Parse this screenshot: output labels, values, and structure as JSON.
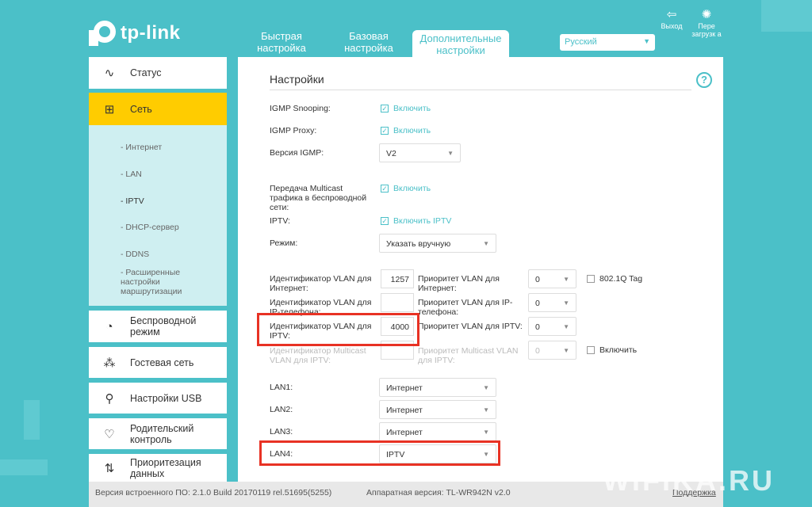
{
  "brand": "tp-link",
  "tabs": [
    {
      "line1": "Быстрая",
      "line2": "настройка"
    },
    {
      "line1": "Базовая",
      "line2": "настройка"
    },
    {
      "line1": "Дополнительные",
      "line2": "настройки"
    }
  ],
  "language": "Русский",
  "top_actions": {
    "logout": "Выход",
    "reboot": "Пере загрузк а"
  },
  "sidebar": {
    "items": [
      {
        "label": "Статус",
        "icon": "pulse-icon"
      },
      {
        "label": "Сеть",
        "icon": "network-icon"
      },
      {
        "label": "Беспроводной режим",
        "icon": "wifi-icon"
      },
      {
        "label": "Гостевая сеть",
        "icon": "guests-icon"
      },
      {
        "label": "Настройки USB",
        "icon": "usb-icon"
      },
      {
        "label": "Родительский контроль",
        "icon": "heart-icon"
      },
      {
        "label": "Приоритезация данных",
        "icon": "arrows-icon"
      }
    ],
    "submenu": [
      "- Интернет",
      "- LAN",
      "- IPTV",
      "- DHCP-сервер",
      "- DDNS",
      "- Расширенные настройки маршрутизации"
    ]
  },
  "main": {
    "title": "Настройки",
    "igmp_snooping_label": "IGMP Snooping:",
    "igmp_snooping_value": "Включить",
    "igmp_proxy_label": "IGMP Proxy:",
    "igmp_proxy_value": "Включить",
    "igmp_version_label": "Версия IGMP:",
    "igmp_version_value": "V2",
    "wireless_multicast_label": "Передача Multicast трафика в беспроводной сети:",
    "wireless_multicast_value": "Включить",
    "iptv_label": "IPTV:",
    "iptv_value": "Включить IPTV",
    "mode_label": "Режим:",
    "mode_value": "Указать вручную",
    "vlan_internet_label": "Идентификатор VLAN для Интернет:",
    "vlan_internet_value": "1257",
    "prio_internet_label": "Приоритет VLAN для Интернет:",
    "prio_internet_value": "0",
    "dot1q_label": "802.1Q Tag",
    "vlan_phone_label": "Идентификатор VLAN для IP-телефона:",
    "vlan_phone_value": "",
    "prio_phone_label": "Приоритет VLAN для IP-телефона:",
    "prio_phone_value": "0",
    "vlan_iptv_label": "Идентификатор VLAN для IPTV:",
    "vlan_iptv_value": "4000",
    "prio_iptv_label": "Приоритет VLAN для IPTV:",
    "prio_iptv_value": "0",
    "vlan_mc_label": "Идентификатор Multicast VLAN для IPTV:",
    "vlan_mc_value": "",
    "prio_mc_label": "Приоритет Multicast VLAN для IPTV:",
    "prio_mc_value": "0",
    "mc_enable_label": "Включить",
    "lan1_label": "LAN1:",
    "lan1_value": "Интернет",
    "lan2_label": "LAN2:",
    "lan2_value": "Интернет",
    "lan3_label": "LAN3:",
    "lan3_value": "Интернет",
    "lan4_label": "LAN4:",
    "lan4_value": "IPTV"
  },
  "footer": {
    "firmware": "Версия встроенного ПО: 2.1.0 Build 20170119 rel.51695(5255)",
    "hardware": "Аппаратная версия: TL-WR942N v2.0",
    "support": "Поддержка"
  },
  "watermark": "WIFIKA.RU",
  "colors": {
    "accent": "#4bc0c8",
    "active": "#ffcc00",
    "highlight": "#e83224"
  }
}
